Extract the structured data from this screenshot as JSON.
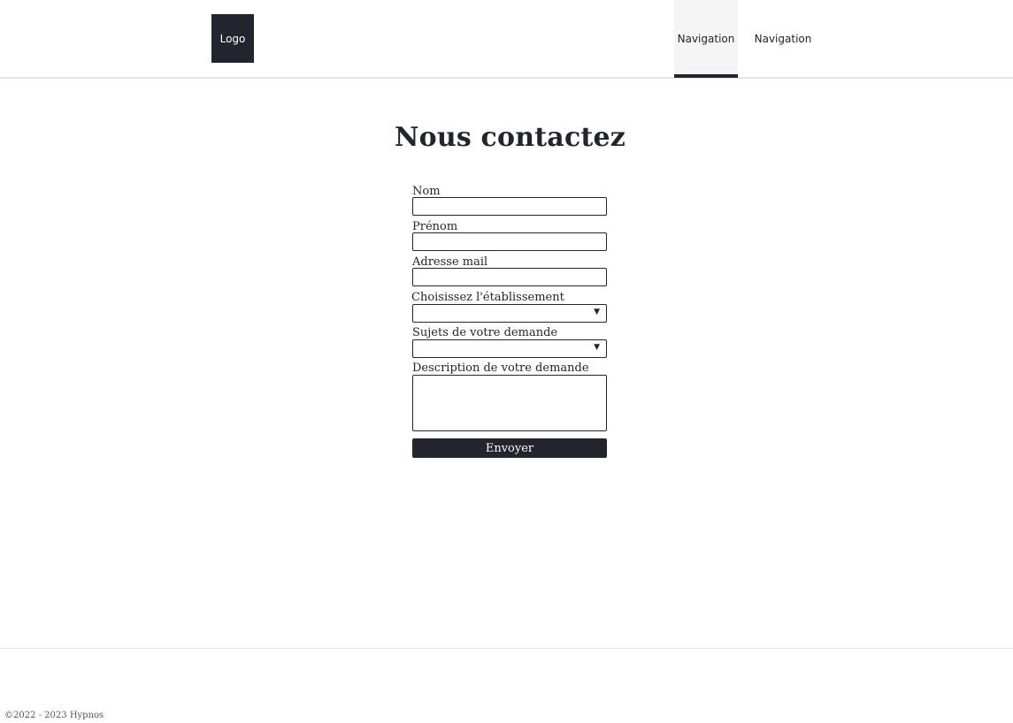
{
  "header": {
    "logo_text": "Logo",
    "nav": [
      {
        "label": "Navigation",
        "active": true
      },
      {
        "label": "Navigation",
        "active": false
      }
    ]
  },
  "main": {
    "title": "Nous contactez",
    "form": {
      "nom_label": "Nom",
      "nom_value": "",
      "prenom_label": "Prénom",
      "prenom_value": "",
      "email_label": "Adresse mail",
      "email_value": "",
      "etablissement_label": "Choisissez l'établissement",
      "etablissement_value": "",
      "sujet_label": "Sujets de votre demande",
      "sujet_value": "",
      "description_label": "Description de votre demande",
      "description_value": "",
      "submit_label": "Envoyer",
      "dropdown_icon": "▼"
    }
  },
  "footer": {
    "copyright": "©2022 - 2023 Hypnos"
  },
  "colors": {
    "primary": "#23252e",
    "border": "#e4e4e4",
    "nav_active_bg": "#f5f5f5"
  }
}
